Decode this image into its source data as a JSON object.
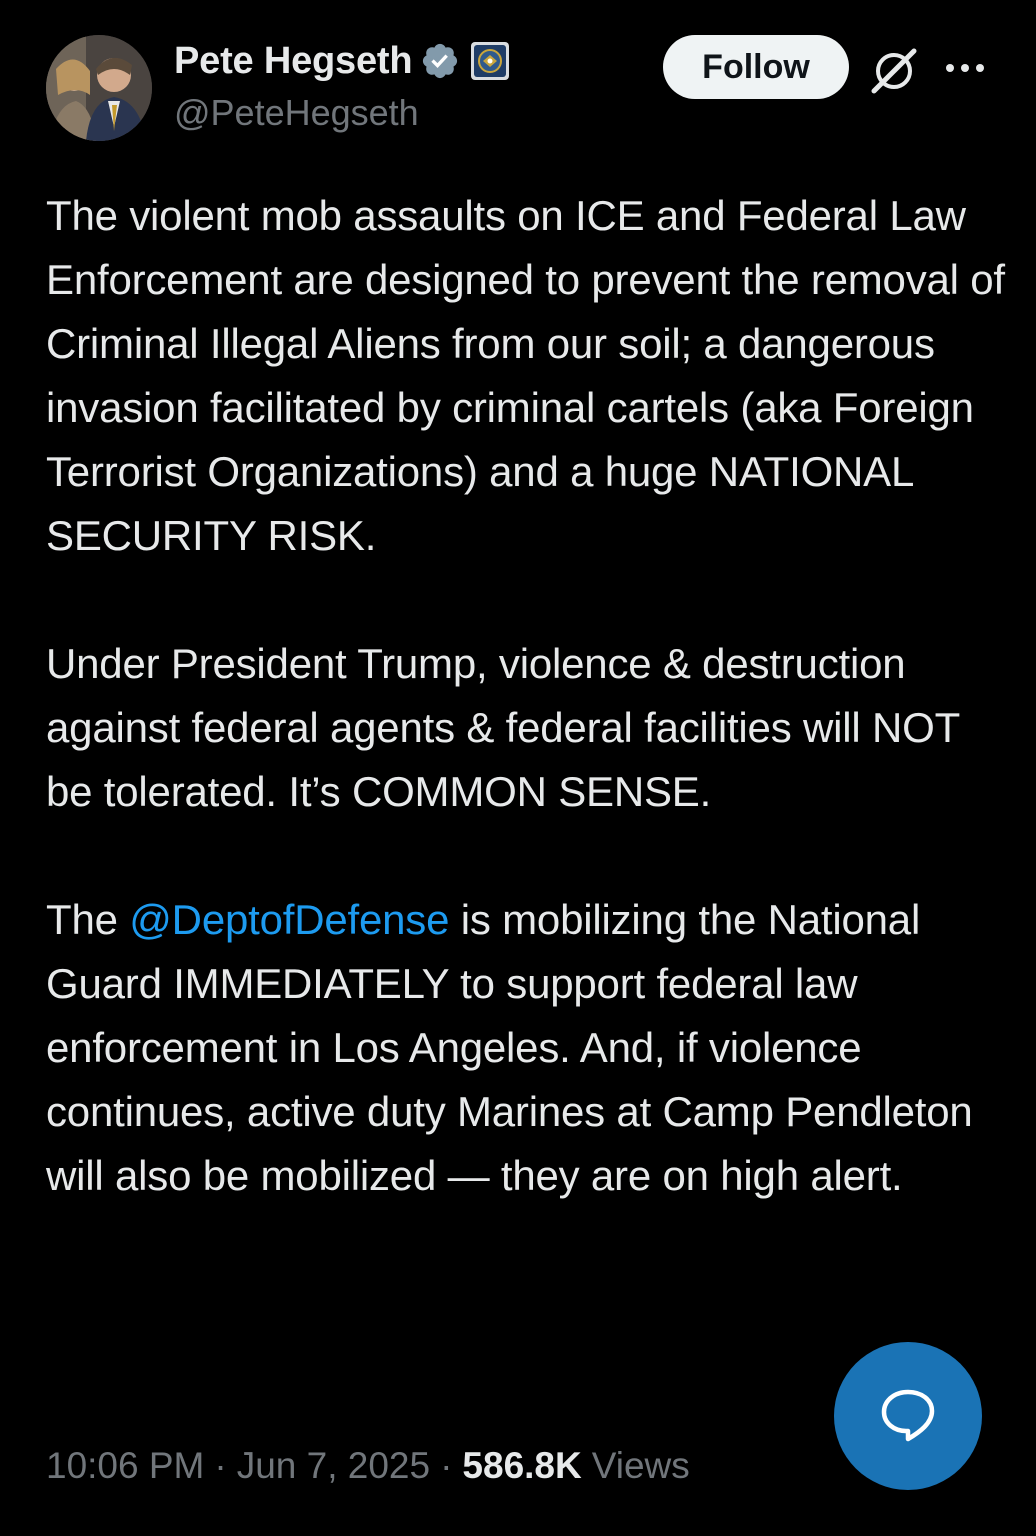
{
  "author": {
    "display_name": "Pete Hegseth",
    "handle": "@PeteHegseth",
    "verified_icon": "verified-badge-icon",
    "affiliate_icon": "dept-of-defense-seal-icon"
  },
  "actions": {
    "follow_label": "Follow",
    "grok_icon": "grok-icon",
    "more_icon": "more-options-icon"
  },
  "tweet": {
    "paragraph1": "The violent mob assaults on ICE and Federal Law Enforcement are designed to prevent the removal of Criminal Illegal Aliens from our soil; a dangerous invasion facilitated by criminal cartels (aka Foreign Terrorist Organizations) and a huge NATIONAL SECURITY RISK.",
    "paragraph2": "Under President Trump, violence & destruction against federal agents & federal facilities will NOT be tolerated. It’s COMMON SENSE.",
    "paragraph3_prefix": "The ",
    "paragraph3_mention": "@DeptofDefense",
    "paragraph3_suffix": " is mobilizing the National Guard IMMEDIATELY to support federal law enforcement in Los Angeles. And, if violence continues, active duty Marines at Camp Pendleton will also be mobilized — they are on high alert."
  },
  "meta": {
    "time": "10:06 PM",
    "separator": "·",
    "date": "Jun 7, 2025",
    "views_count": "586.8K",
    "views_label": "Views"
  },
  "fab": {
    "icon": "reply-bubble-icon"
  },
  "colors": {
    "background": "#000000",
    "text": "#e7e9ea",
    "secondary_text": "#71767b",
    "link": "#1d9bf0",
    "verified": "#829aab",
    "fab": "#1a73b5"
  }
}
